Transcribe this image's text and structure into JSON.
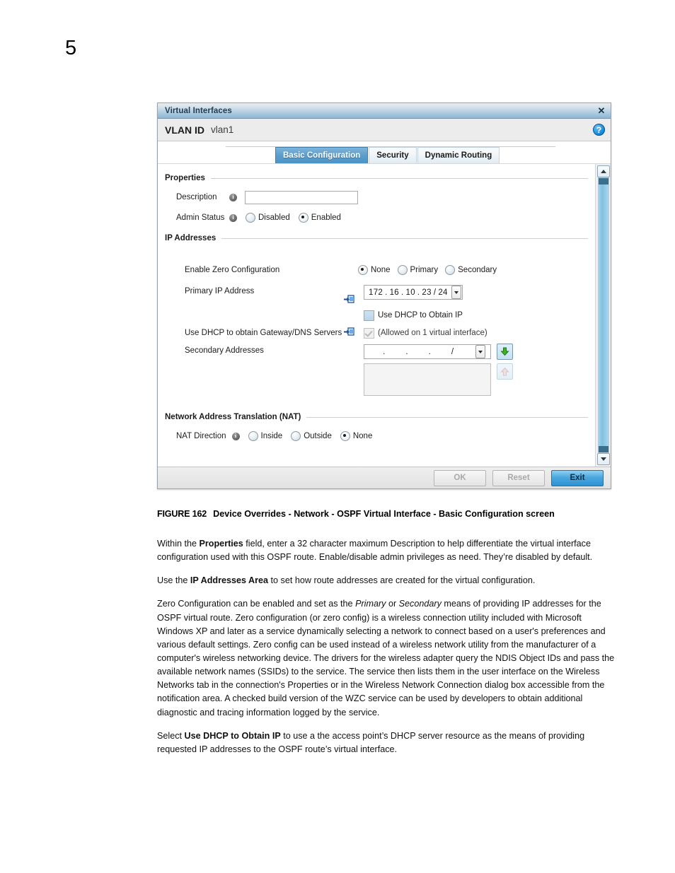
{
  "page": {
    "number": "5"
  },
  "dialog": {
    "title": "Virtual Interfaces",
    "close_icon": "close-icon",
    "help_icon": "help-icon",
    "subheader": {
      "label": "VLAN ID",
      "value": "vlan1"
    },
    "tabs": [
      {
        "label": "Basic Configuration",
        "active": true
      },
      {
        "label": "Security",
        "active": false
      },
      {
        "label": "Dynamic Routing",
        "active": false
      }
    ],
    "sections": {
      "properties": {
        "title": "Properties",
        "description": {
          "label": "Description",
          "value": "",
          "placeholder": ""
        },
        "admin_status": {
          "label": "Admin Status",
          "options": [
            "Disabled",
            "Enabled"
          ],
          "selected": "Enabled"
        }
      },
      "ip_addresses": {
        "title": "IP Addresses",
        "zero_config": {
          "label": "Enable Zero Configuration",
          "options": [
            "None",
            "Primary",
            "Secondary"
          ],
          "selected": "None"
        },
        "primary_ip": {
          "label": "Primary IP Address",
          "octet1": "172",
          "octet2": "16",
          "octet3": "10",
          "octet4": "23",
          "mask": "24"
        },
        "use_dhcp_ip": {
          "label": "Use DHCP to Obtain IP",
          "checked": false
        },
        "use_dhcp_gateway": {
          "label": "Use DHCP to obtain Gateway/DNS Servers",
          "note": "(Allowed on 1 virtual interface)",
          "checked": true,
          "disabled": true
        },
        "secondary_addresses": {
          "label": "Secondary Addresses",
          "octet1": "",
          "octet2": "",
          "octet3": "",
          "octet4": "",
          "mask": "",
          "add_button_icon": "green-down-arrow-icon",
          "remove_button_icon": "up-arrow-icon",
          "list_values": []
        }
      },
      "nat": {
        "title": "Network Address Translation (NAT)",
        "nat_direction": {
          "label": "NAT Direction",
          "options": [
            "Inside",
            "Outside",
            "None"
          ],
          "selected": "None"
        }
      }
    },
    "footer": {
      "ok": "OK",
      "reset": "Reset",
      "exit": "Exit"
    }
  },
  "figure": {
    "number": "FIGURE 162",
    "title": "Device Overrides - Network - OSPF Virtual Interface - Basic Configuration screen"
  },
  "prose": {
    "p1_a": "Within the ",
    "p1_b": "Properties",
    "p1_c": " field, enter a 32 character maximum Description to help differentiate the virtual interface configuration used with this OSPF route. Enable/disable admin privileges as need. They’re disabled by default.",
    "p2_a": "Use the ",
    "p2_b": "IP Addresses Area",
    "p2_c": " to set how route addresses are created for the virtual configuration.",
    "p3_a": "Zero Configuration can be enabled and set as the ",
    "p3_b": "Primary",
    "p3_c": " or ",
    "p3_d": "Secondary",
    "p3_e": " means of providing IP addresses for the OSPF virtual route. Zero configuration (or zero config) is a wireless connection utility included with Microsoft Windows XP and later as a service dynamically selecting a network to connect based on a user's preferences and various default settings. Zero config can be used instead of a wireless network utility from the manufacturer of a computer's wireless networking device. The drivers for the wireless adapter query the NDIS Object IDs and pass the available network names (SSIDs) to the service. The service then lists them in the user interface on the Wireless Networks tab in the connection's Properties or in the Wireless Network Connection dialog box accessible from the notification area. A checked build version of the WZC service can be used by developers to obtain additional diagnostic and tracing information logged by the service.",
    "p4_a": "Select ",
    "p4_b": "Use DHCP to Obtain IP",
    "p4_c": " to use a the access point’s DHCP server resource as the means of providing requested IP addresses to the OSPF route’s virtual interface."
  }
}
